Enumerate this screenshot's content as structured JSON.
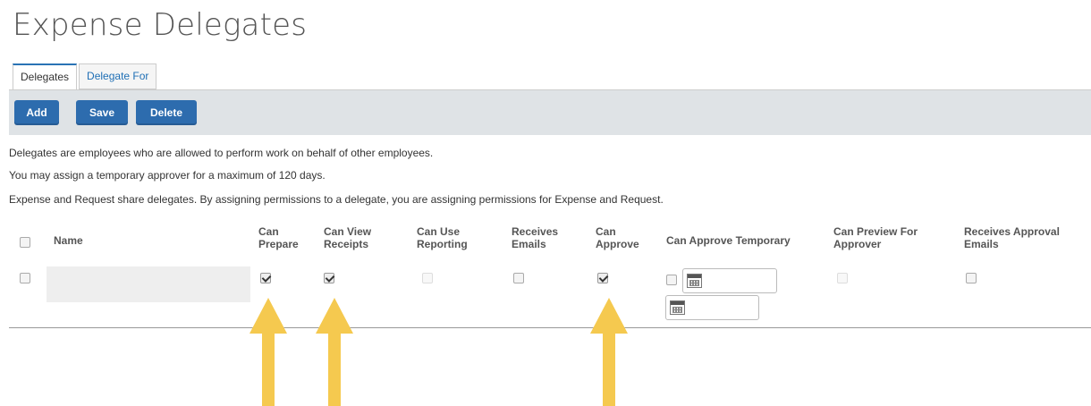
{
  "page": {
    "title": "Expense Delegates"
  },
  "tabs": [
    {
      "label": "Delegates",
      "active": true
    },
    {
      "label": "Delegate For",
      "active": false
    }
  ],
  "toolbar": {
    "add_label": "Add",
    "save_label": "Save",
    "delete_label": "Delete"
  },
  "info": [
    "Delegates are employees who are allowed to perform work on behalf of other employees.",
    "You may assign a temporary approver for a maximum of 120 days.",
    "Expense and Request share delegates. By assigning permissions to a delegate, you are assigning permissions for Expense and Request."
  ],
  "table": {
    "headers": {
      "name": "Name",
      "can_prepare": [
        "Can",
        "Prepare"
      ],
      "can_view_receipts": [
        "Can View",
        "Receipts"
      ],
      "can_use_reporting": [
        "Can Use",
        "Reporting"
      ],
      "receives_emails": [
        "Receives",
        "Emails"
      ],
      "can_approve": [
        "Can",
        "Approve"
      ],
      "can_approve_temporary": "Can Approve Temporary",
      "can_preview_for_approver": [
        "Can Preview For",
        "Approver"
      ],
      "receives_approval_emails": [
        "Receives Approval",
        "Emails"
      ]
    },
    "row": {
      "name": "",
      "can_prepare": true,
      "can_view_receipts": true,
      "can_use_reporting": false,
      "receives_emails": false,
      "can_approve": true,
      "can_approve_temporary": false,
      "can_preview_for_approver": false,
      "receives_approval_emails": false,
      "temp_start_date": "",
      "temp_end_date": ""
    }
  },
  "colors": {
    "button": "#2d6cae",
    "toolbar": "#dfe3e6",
    "arrow": "#f5c94f",
    "tab_link": "#1f6fb5"
  },
  "icons": [
    "calendar-icon",
    "up-arrow-annotation"
  ]
}
